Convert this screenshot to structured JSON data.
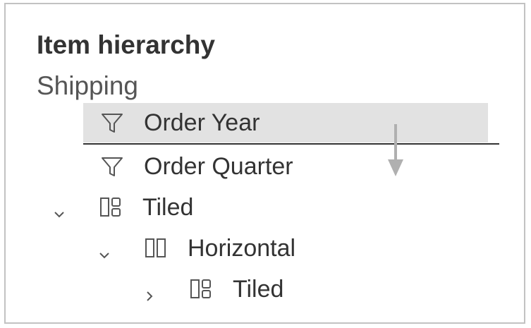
{
  "panel": {
    "title": "Item hierarchy",
    "subtitle": "Shipping"
  },
  "items": [
    {
      "label": "Order Year",
      "icon": "filter-icon",
      "selected": true
    },
    {
      "label": "Order Quarter",
      "icon": "filter-icon",
      "selected": false
    },
    {
      "label": "Tiled",
      "icon": "tiled-layout-icon",
      "expander": "chevron-down-icon"
    },
    {
      "label": "Horizontal",
      "icon": "horizontal-layout-icon",
      "expander": "chevron-down-icon"
    },
    {
      "label": "Tiled",
      "icon": "tiled-layout-icon",
      "expander": "chevron-right-icon"
    }
  ],
  "colors": {
    "selection": "#e2e2e2",
    "text": "#333333",
    "drop_indicator": "#333333",
    "drag_arrow": "#b0b0b0"
  }
}
